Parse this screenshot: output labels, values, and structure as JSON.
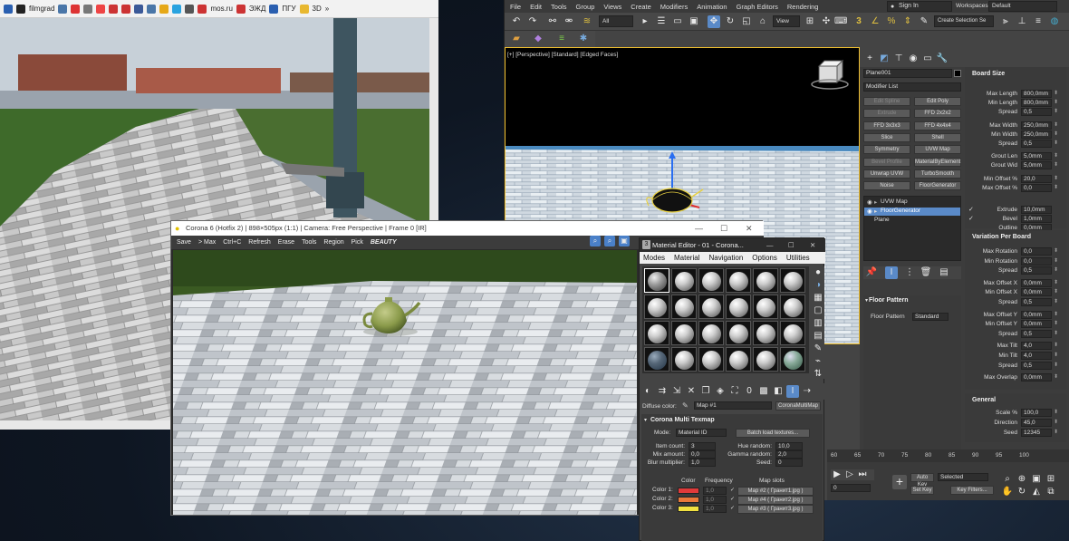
{
  "browser": {
    "bookmarks": [
      "filmgrad",
      "mos.ru",
      "ЭЖД",
      "ПГУ",
      "3D"
    ]
  },
  "max": {
    "menus": [
      "File",
      "Edit",
      "Tools",
      "Group",
      "Views",
      "Create",
      "Modifiers",
      "Animation",
      "Graph Editors",
      "Rendering"
    ],
    "signin": "Sign In",
    "workspaces_label": "Workspaces:",
    "workspaces_value": "Default",
    "filter_all": "All",
    "view": "View",
    "create_selection": "Create Selection Se",
    "viewport_label": "[+] [Perspective] [Standard] [Edged Faces]",
    "object_name": "Plane001",
    "modifier_list": "Modifier List",
    "modifier_buttons": [
      {
        "label": "Edit Spline",
        "dim": true
      },
      {
        "label": "Edit Poly",
        "dim": false
      },
      {
        "label": "Extrude",
        "dim": true
      },
      {
        "label": "FFD 2x2x2",
        "dim": false
      },
      {
        "label": "FFD 3x3x3",
        "dim": false
      },
      {
        "label": "FFD 4x4x4",
        "dim": false
      },
      {
        "label": "Slice",
        "dim": false
      },
      {
        "label": "Shell",
        "dim": false
      },
      {
        "label": "Symmetry",
        "dim": false
      },
      {
        "label": "UVW Map",
        "dim": false
      },
      {
        "label": "Bevel Profile",
        "dim": true
      },
      {
        "label": "MaterialByElement",
        "dim": false
      },
      {
        "label": "Unwrap UVW",
        "dim": false
      },
      {
        "label": "TurboSmooth",
        "dim": false
      },
      {
        "label": "Noise",
        "dim": false
      },
      {
        "label": "FloorGenerator",
        "dim": false
      }
    ],
    "stack": [
      "UVW Map",
      "FloorGenerator",
      "Plane"
    ],
    "floor_pattern_section": "Floor Pattern",
    "floor_pattern_label": "Floor Pattern",
    "floor_pattern_value": "Standard",
    "board_size": {
      "title": "Board Size",
      "rows": [
        {
          "label": "Max Length",
          "value": "800,0mm"
        },
        {
          "label": "Min Length",
          "value": "800,0mm"
        },
        {
          "label": "Spread",
          "value": "0,5"
        },
        {
          "label": "Max Width",
          "value": "250,0mm"
        },
        {
          "label": "Min Width",
          "value": "250,0mm"
        },
        {
          "label": "Spread",
          "value": "0,5"
        },
        {
          "label": "Grout Len",
          "value": "5,0mm"
        },
        {
          "label": "Grout Wid",
          "value": "5,0mm"
        },
        {
          "label": "Min Offset %",
          "value": "20,0"
        },
        {
          "label": "Max Offset %",
          "value": "0,0"
        }
      ],
      "extrude_label": "Extrude",
      "extrude_value": "10,0mm",
      "bevel_label": "Bevel",
      "bevel_value": "1,0mm",
      "outline_label": "Outline",
      "outline_value": "0,0mm"
    },
    "variation": {
      "title": "Variation Per Board",
      "rows": [
        {
          "label": "Max Rotation",
          "value": "0,0"
        },
        {
          "label": "Min Rotation",
          "value": "0,0"
        },
        {
          "label": "Spread",
          "value": "0,5"
        },
        {
          "label": "Max Offset X",
          "value": "0,0mm"
        },
        {
          "label": "Min Offset X",
          "value": "0,0mm"
        },
        {
          "label": "Spread",
          "value": "0,5"
        },
        {
          "label": "Max Offset Y",
          "value": "0,0mm"
        },
        {
          "label": "Min Offset Y",
          "value": "0,0mm"
        },
        {
          "label": "Spread",
          "value": "0,5"
        },
        {
          "label": "Max Tilt",
          "value": "4,0"
        },
        {
          "label": "Min Tilt",
          "value": "4,0"
        },
        {
          "label": "Spread",
          "value": "0,5"
        },
        {
          "label": "Max Overlap",
          "value": "0,0mm"
        }
      ]
    },
    "general": {
      "title": "General",
      "rows": [
        {
          "label": "Scale %",
          "value": "100,0"
        },
        {
          "label": "Direction",
          "value": "45,0"
        },
        {
          "label": "Seed",
          "value": "12345"
        }
      ]
    },
    "timeline": {
      "ticks": [
        "60",
        "65",
        "70",
        "75",
        "80",
        "85",
        "90",
        "95",
        "100"
      ],
      "frame": "0",
      "auto_key": "Auto Key",
      "set_key": "Set Key",
      "selected": "Selected",
      "key_filters": "Key Filters..."
    }
  },
  "vfb": {
    "title": "Corona 6 (Hotfix 2) | 898×505px (1:1) | Camera: Free Perspective | Frame 0 [IR]",
    "tools": [
      "Save",
      "> Max",
      "Ctrl+C",
      "Refresh",
      "Erase",
      "Tools",
      "Region",
      "Pick"
    ],
    "channel": "BEAUTY"
  },
  "med": {
    "title": "Material Editor - 01 - Corona...",
    "menus": [
      "Modes",
      "Material",
      "Navigation",
      "Options",
      "Utilities"
    ],
    "diffuse_label": "Diffuse color:",
    "map_name": "Map #1",
    "map_type": "CoronaMultiMap",
    "rollout": "Corona Multi Texmap",
    "mode_label": "Mode:",
    "mode_value": "Material ID",
    "batch": "Batch load textures...",
    "params": [
      {
        "label": "Item count:",
        "value": "3"
      },
      {
        "label": "Mix amount:",
        "value": "0,0"
      },
      {
        "label": "Blur multiplier:",
        "value": "1,0"
      }
    ],
    "rparams": [
      {
        "label": "Hue random:",
        "value": "10,0"
      },
      {
        "label": "Gamma random:",
        "value": "2,0"
      },
      {
        "label": "Seed:",
        "value": "0"
      }
    ],
    "table_headers": [
      "Color",
      "Frequency",
      "Map slots"
    ],
    "colors": [
      {
        "label": "Color 1:",
        "swatch": "#e03a3a",
        "freq": "1,0",
        "map": "Map #2 ( Гранит1.jpg )"
      },
      {
        "label": "Color 2:",
        "swatch": "#e8783a",
        "freq": "1,0",
        "map": "Map #4 ( Гранит2.jpg )"
      },
      {
        "label": "Color 3:",
        "swatch": "#f0e040",
        "freq": "1,0",
        "map": "Map #3 ( Гранит3.jpg )"
      }
    ]
  }
}
